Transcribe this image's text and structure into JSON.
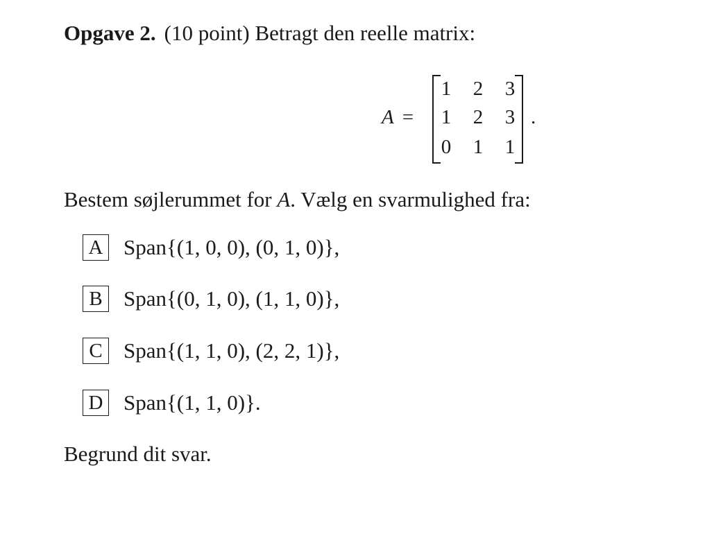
{
  "heading": {
    "label": "Opgave 2.",
    "text": "(10 point) Betragt den reelle matrix:"
  },
  "equation": {
    "variable": "A",
    "equals": "=",
    "matrix": [
      [
        "1",
        "2",
        "3"
      ],
      [
        "1",
        "2",
        "3"
      ],
      [
        "0",
        "1",
        "1"
      ]
    ],
    "trailing": "."
  },
  "question": {
    "before": "Bestem søjlerummet for ",
    "variable": "A",
    "after": ". Vælg en svarmulighed fra:"
  },
  "options": [
    {
      "letter": "A",
      "text": "Span{(1, 0, 0), (0, 1, 0)},"
    },
    {
      "letter": "B",
      "text": "Span{(0, 1, 0), (1, 1, 0)},"
    },
    {
      "letter": "C",
      "text": "Span{(1, 1, 0), (2, 2, 1)},"
    },
    {
      "letter": "D",
      "text": "Span{(1, 1, 0)}."
    }
  ],
  "footer": "Begrund dit svar."
}
